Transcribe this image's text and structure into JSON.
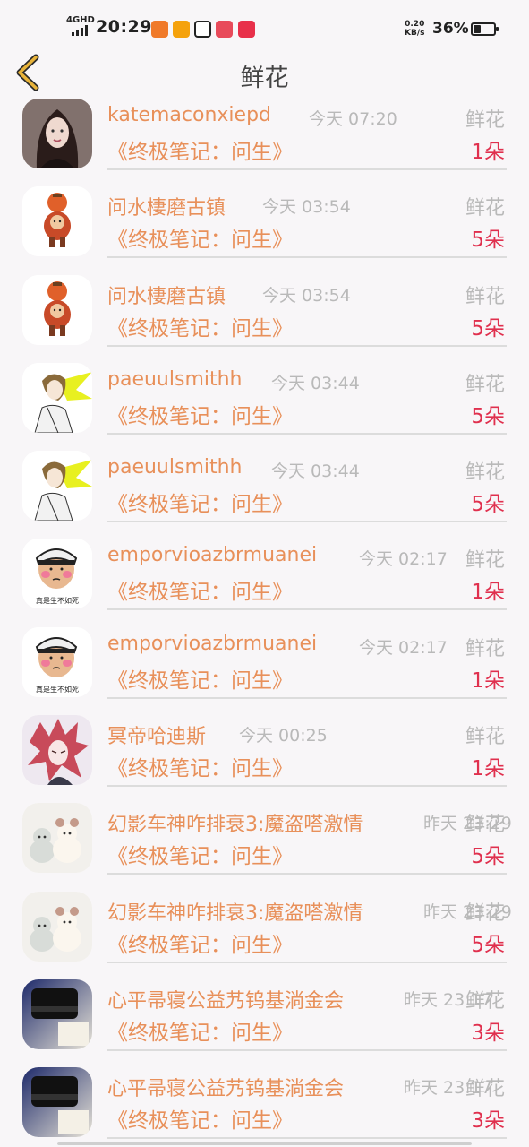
{
  "status_bar": {
    "network": "4GHD",
    "time": "20:29",
    "speed_value": "0.20",
    "speed_unit": "KB/s",
    "battery_percent": "36%",
    "battery_level": 0.36
  },
  "header": {
    "title": "鲜花",
    "back_icon": "chevron-left-icon"
  },
  "colors": {
    "name": "#e8905a",
    "time": "#b9b9b9",
    "count": "#e0304e",
    "back": "#e8b33a"
  },
  "records": [
    {
      "user": "katemaconxiepd",
      "time": "今天 07:20",
      "gift": "鲜花",
      "book": "《终极笔记：问生》",
      "count": "1朵",
      "avatar": "woman-portrait"
    },
    {
      "user": "问水棲磨古镇",
      "time": "今天 03:54",
      "gift": "鲜花",
      "book": "《终极笔记：问生》",
      "count": "5朵",
      "avatar": "cartoon-lantern"
    },
    {
      "user": "问水棲磨古镇",
      "time": "今天 03:54",
      "gift": "鲜花",
      "book": "《终极笔记：问生》",
      "count": "5朵",
      "avatar": "cartoon-lantern"
    },
    {
      "user": "paeuulsmithh",
      "time": "今天 03:44",
      "gift": "鲜花",
      "book": "《终极笔记：问生》",
      "count": "5朵",
      "avatar": "anime-boy-yellow"
    },
    {
      "user": "paeuulsmithh",
      "time": "今天 03:44",
      "gift": "鲜花",
      "book": "《终极笔记：问生》",
      "count": "5朵",
      "avatar": "anime-boy-yellow"
    },
    {
      "user": "emporvioazbrmuanei",
      "time": "今天 02:17",
      "gift": "鲜花",
      "book": "《终极笔记：问生》",
      "count": "1朵",
      "avatar": "meme-face",
      "avatar_caption": "真是生不如死"
    },
    {
      "user": "emporvioazbrmuanei",
      "time": "今天 02:17",
      "gift": "鲜花",
      "book": "《终极笔记：问生》",
      "count": "1朵",
      "avatar": "meme-face",
      "avatar_caption": "真是生不如死"
    },
    {
      "user": "冥帝哈迪斯",
      "time": "今天 00:25",
      "gift": "鲜花",
      "book": "《终极笔记：问生》",
      "count": "1朵",
      "avatar": "anime-red-hair"
    },
    {
      "user": "幻影车神咋排衰3:魔盗嗒激情",
      "time": "昨天 23:29",
      "gift": "鲜花",
      "book": "《终极笔记：问生》",
      "count": "5朵",
      "avatar": "plush-toys"
    },
    {
      "user": "幻影车神咋排衰3:魔盗嗒激情",
      "time": "昨天 23:29",
      "gift": "鲜花",
      "book": "《终极笔记：问生》",
      "count": "5朵",
      "avatar": "plush-toys"
    },
    {
      "user": "心平帚寝公益艿钨基淌金会",
      "time": "昨天 23:17",
      "gift": "鲜花",
      "book": "《终极笔记：问生》",
      "count": "3朵",
      "avatar": "camera-lens"
    },
    {
      "user": "心平帚寝公益艿钨基淌金会",
      "time": "昨天 23:17",
      "gift": "鲜花",
      "book": "《终极笔记：问生》",
      "count": "3朵",
      "avatar": "camera-lens"
    }
  ]
}
